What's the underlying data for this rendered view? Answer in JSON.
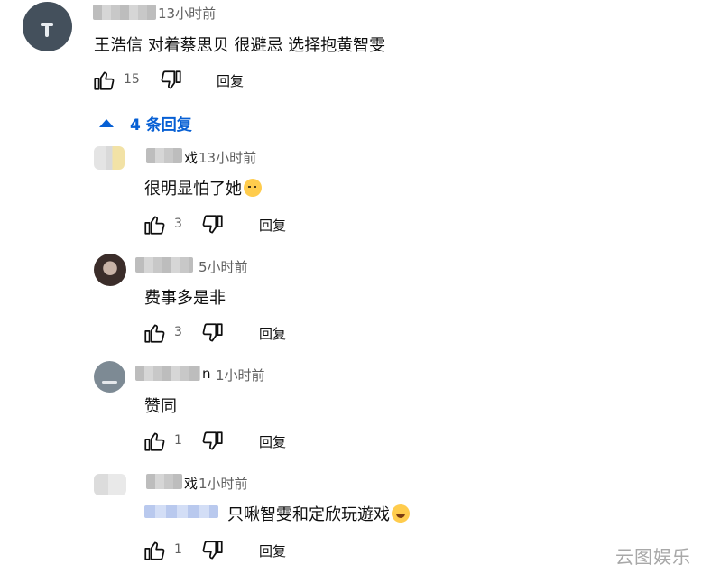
{
  "main_comment": {
    "time": "13小时前",
    "text": "王浩信 对着蔡思贝 很避忌 选择抱黄智雯",
    "likes": "15",
    "reply_label": "回复"
  },
  "replies_toggle": {
    "label": "4 条回复",
    "icon": "triangle-up-icon",
    "color": "#065fd4"
  },
  "replies": [
    {
      "name_suffix": "戏",
      "time": "13小时前",
      "text": "很明显怕了她",
      "emoji": "sleepy-face-emoji",
      "likes": "3",
      "reply_label": "回复"
    },
    {
      "name_suffix": "",
      "time": "5小时前",
      "text": "费事多是非",
      "emoji": "",
      "likes": "3",
      "reply_label": "回复"
    },
    {
      "name_suffix": "n",
      "time": "1小时前",
      "text": "赞同",
      "emoji": "",
      "likes": "1",
      "reply_label": "回复"
    },
    {
      "name_suffix": "戏",
      "time": "1小时前",
      "text": "只啾智雯和定欣玩遊戏",
      "emoji": "rolling-on-floor-laughing-emoji",
      "likes": "1",
      "reply_label": "回复"
    }
  ],
  "watermark": "云图娱乐"
}
